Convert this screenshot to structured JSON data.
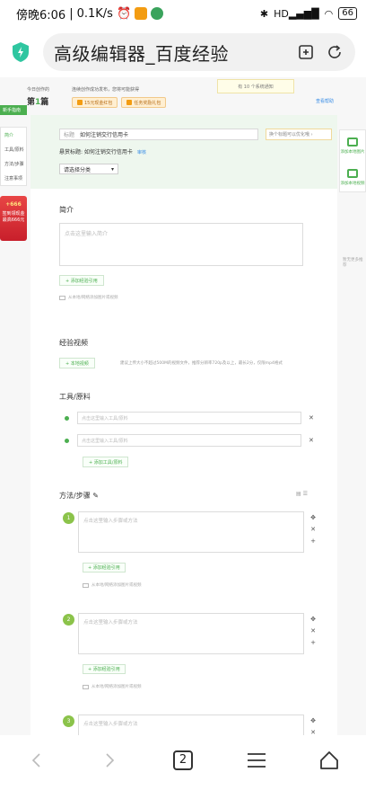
{
  "status_bar": {
    "time_label": "傍晚6:06",
    "net_speed": "0.1K/s",
    "signal_text": "HD",
    "battery": "66"
  },
  "browser": {
    "page_title": "高级编辑器_百度经验",
    "tabs_count": "2"
  },
  "page": {
    "top_note": "有 10 个系统通知",
    "today_label": "今日创作的",
    "article_count_prefix": "第",
    "article_count_num": "1",
    "article_count_suffix": "篇",
    "continue_tip": "连续创作成功发布，您将可能获得",
    "pill_red_packet": "15元现金红包",
    "pill_task": "任务奖励礼包",
    "help_link": "查看帮助",
    "left_button": "新手指南",
    "sidebar": [
      "简介",
      "工具/原料",
      "方法/步骤",
      "注意事项"
    ],
    "promo_amount": "+666",
    "promo_text": "签到领现金 最高666元",
    "title_label": "标题",
    "title_value": "如何注销交行信用卡",
    "title_hint": "换个标题可以优化哦 ›",
    "suspend_label": "悬赏标题: 如何注销交行信用卡",
    "suspend_link": "审核",
    "category_placeholder": "请选择分类",
    "intro_title": "简介",
    "intro_placeholder": "点击这里输入简介",
    "add_ref_button": "+ 添加经验引用",
    "pic_hint": "从本地/网络添加图片或视频",
    "video_title": "经验视频",
    "local_video_button": "+ 本地视频",
    "video_hint": "建议上传大小不超过500M的视频文件，推荐分辨率720p及以上，最长2分，仅限mp4格式",
    "tools_title": "工具/原料",
    "tool_placeholder": "点击这里输入工具/原料",
    "add_tool_button": "+ 添加工具/原料",
    "steps_title": "方法/步骤",
    "step_placeholder": "点击这里输入步骤或方法",
    "step_add_ref": "+ 添加经验引用",
    "step_pic_hint": "从本地/网络添加图片或视频",
    "steps": [
      "1",
      "2",
      "3"
    ],
    "right_panel": [
      "添加本地图片",
      "添加本地视频"
    ],
    "right_note": "暂无更多推荐"
  }
}
